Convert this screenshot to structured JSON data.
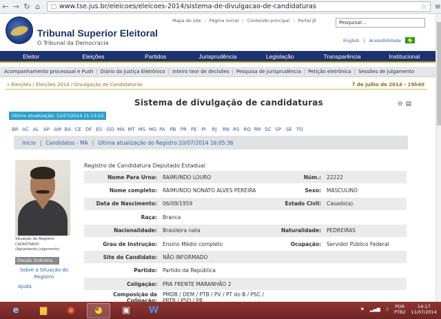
{
  "browser": {
    "url": "www.tse.jus.br/eleicoes/eleicoes-2014/sistema-de-divulgacao-de-candidaturas"
  },
  "header": {
    "title": "Tribunal Superior Eleitoral",
    "subtitle": "O Tribunal da Democracia",
    "top_links": [
      "Mapa do site",
      "Página inicial",
      "Conteúdo principal",
      "Portal JE"
    ],
    "search_placeholder": "Pesquisar...",
    "lang": [
      "English",
      "Acessibilidade"
    ]
  },
  "mainnav": [
    "Eleitor",
    "Eleições",
    "Partidos",
    "Jurisprudência",
    "Legislação",
    "Transparência",
    "Institucional"
  ],
  "subnav": [
    "Acompanhamento processual e Push",
    "Diário da Justiça Eletrônico",
    "Inteiro teor de decisões",
    "Pesquisa de Jurisprudência",
    "Petição eletrônica",
    "Sessões de julgamento"
  ],
  "breadcrumb": {
    "path": "» Eleições / Eleições 2014 / Divulgação de Candidaturas",
    "date": "7 de julho de 2014 - 19h40"
  },
  "page_title": "Sistema de divulgação de candidaturas",
  "updated_badge": "Última atualização: 11/07/2014 11:13:22",
  "states": [
    "BR",
    "AC",
    "AL",
    "AP",
    "AM",
    "BA",
    "CE",
    "DF",
    "ES",
    "GO",
    "MA",
    "MT",
    "MS",
    "MG",
    "PA",
    "PB",
    "PR",
    "PE",
    "PI",
    "RJ",
    "RN",
    "RS",
    "RO",
    "RR",
    "SC",
    "SP",
    "SE",
    "TO"
  ],
  "crumb2": [
    "Início",
    "Candidatos - MA",
    "Última atualização do Registro:10/07/2014 16:05:36"
  ],
  "side": {
    "situacao_label": "Situação do Registro",
    "situacao_val": "CADASTRADO",
    "situacao_val2": "(Aguardando Julgamento)",
    "eleicao_btn": "Eleição Ordinária",
    "sobre_link": "Sobre a Situação do Registro",
    "ajuda": "Ajuda"
  },
  "detail": {
    "heading": "Registro de Candidatura Deputado Estadual",
    "rows": [
      {
        "k1": "Nome Para Urna:",
        "v1": "RAIMUNDO LOURO",
        "k2": "Núm.:",
        "v2": "22222"
      },
      {
        "k1": "Nome completo:",
        "v1": "RAIMUNDO NONATO ALVES PEREIRA",
        "k2": "Sexo:",
        "v2": "MASCULINO"
      },
      {
        "k1": "Data de Nascimento:",
        "v1": "06/09/1959",
        "k2": "Estado Civil:",
        "v2": "Casado(a)"
      },
      {
        "k1": "Raça:",
        "v1": "Branca",
        "k2": "",
        "v2": ""
      },
      {
        "k1": "Nacionalidade:",
        "v1": "Brasileira nata",
        "k2": "Naturalidade:",
        "v2": "PEDREIRAS"
      },
      {
        "k1": "Grau de Instrução:",
        "v1": "Ensino Médio completo",
        "k2": "Ocupação:",
        "v2": "Servidor Público Federal"
      },
      {
        "k1": "Site do Candidato:",
        "v1": "NÃO INFORMADO",
        "k2": "",
        "v2": ""
      },
      {
        "k1": "Partido:",
        "v1": "Partido da República",
        "k2": "",
        "v2": ""
      },
      {
        "k1": "Coligação:",
        "v1": "PRA FRENTE MARANHÃO 2",
        "k2": "",
        "v2": ""
      },
      {
        "k1": "Composição da Coligação:",
        "v1": "PMDB / DEM / PTB / PV / PT do B / PSC / PRTB / PSD / PR",
        "k2": "",
        "v2": ""
      }
    ]
  },
  "taskbar": {
    "lang": "POR",
    "lang2": "PTB2",
    "time": "14:17",
    "date": "11/07/2014"
  }
}
